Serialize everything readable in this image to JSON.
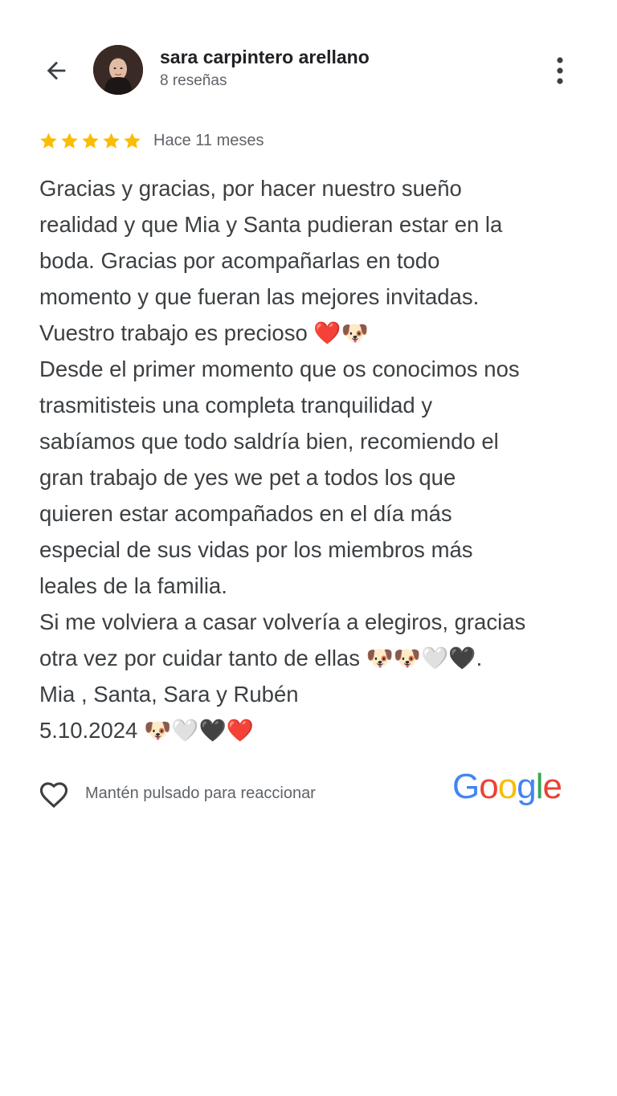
{
  "header": {
    "back_icon": "arrow-left-icon",
    "avatar_icon": "profile-photo",
    "name": "sara carpintero arellano",
    "reviews_count": "8 reseñas",
    "more_icon": "more-vertical-icon"
  },
  "rating": {
    "stars": 5,
    "max_stars": 5,
    "star_color": "#FBBC04",
    "time": "Hace 11 meses"
  },
  "review": {
    "lines": [
      "Gracias y gracias, por hacer nuestro sueño",
      "realidad y que Mia y Santa pudieran estar en la",
      "boda. Gracias por acompañarlas en todo",
      "momento y que fueran las mejores invitadas.",
      "Vuestro trabajo es precioso ❤️🐶",
      "Desde el primer momento que os conocimos nos",
      "trasmitisteis una completa tranquilidad y",
      "sabíamos que todo saldría bien, recomiendo el",
      "gran trabajo de yes we pet a todos los que",
      "quieren estar acompañados en el día más",
      "especial de sus vidas por los miembros más",
      "leales de la familia.",
      "Si me volviera a casar volvería a elegiros, gracias",
      "otra vez por cuidar tanto de ellas 🐶🐶🤍🖤.",
      "Mia , Santa, Sara y Rubén",
      "5.10.2024 🐶🤍🖤❤️"
    ]
  },
  "footer": {
    "heart_icon": "heart-outline-icon",
    "react_label": "Mantén pulsado para reaccionar",
    "google_logo": {
      "letters": [
        "G",
        "o",
        "o",
        "g",
        "l",
        "e"
      ],
      "colors": [
        "#4285F4",
        "#EA4335",
        "#FBBC05",
        "#4285F4",
        "#34A853",
        "#EA4335"
      ]
    }
  }
}
